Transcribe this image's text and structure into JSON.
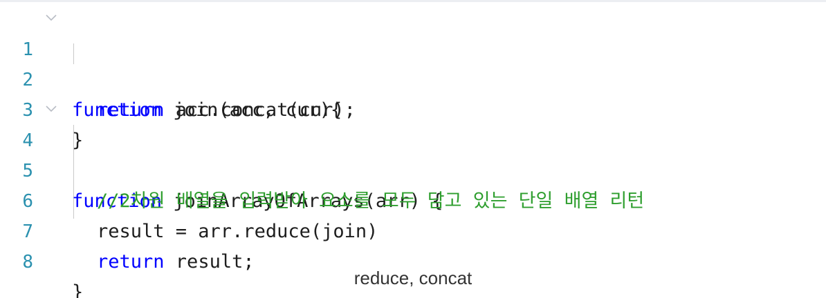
{
  "editor": {
    "lines": [
      {
        "number": "1",
        "keyword": "function",
        "rest": " join(acc, cur){"
      },
      {
        "number": "2",
        "keyword": "return",
        "rest": " acc.concat(cur);"
      },
      {
        "number": "3",
        "text": "}"
      },
      {
        "number": "4",
        "keyword": "function",
        "rest": " joinArrayOfArrays(arr) {"
      },
      {
        "number": "5",
        "comment": "//2차원 배열을 입력받아 요소를 모두 담고 있는 단일 배열 리턴"
      },
      {
        "number": "6",
        "text": "result = arr.reduce(join)"
      },
      {
        "number": "7",
        "keyword": "return",
        "rest": " result;"
      },
      {
        "number": "8",
        "text": "}"
      }
    ]
  },
  "caption": "reduce, concat",
  "colors": {
    "keyword": "#0000ff",
    "comment": "#2e9e2e",
    "line_number": "#2b91af",
    "text": "#1e1e1e"
  },
  "icons": [
    "fold-chevron-icon"
  ]
}
